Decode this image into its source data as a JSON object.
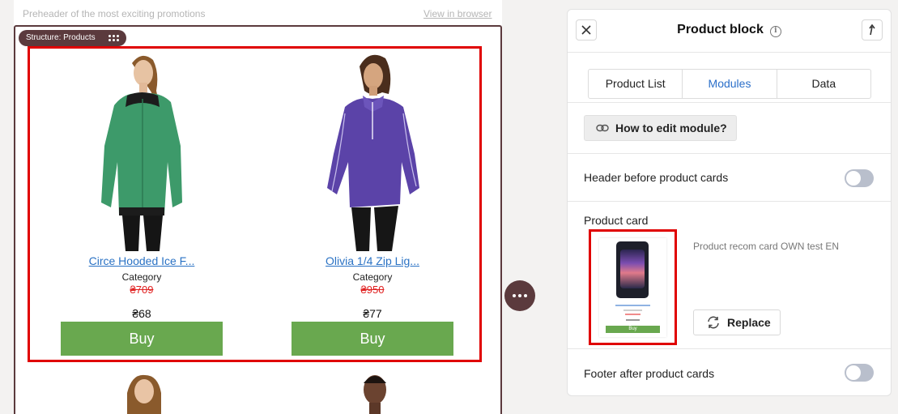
{
  "email": {
    "preheader": "Preheader of the most exciting promotions",
    "view_in_browser": "View in browser",
    "structure_tag": "Structure: Products",
    "products": [
      {
        "name": "Circe Hooded Ice F...",
        "category": "Category",
        "old_price": "₴709",
        "price": "₴68",
        "buy_label": "Buy",
        "jacket_color": "#3d9a6a"
      },
      {
        "name": "Olivia 1/4 Zip Lig...",
        "category": "Category",
        "old_price": "₴950",
        "price": "₴77",
        "buy_label": "Buy",
        "jacket_color": "#5b43a8"
      }
    ]
  },
  "panel": {
    "title": "Product block",
    "tabs": [
      {
        "label": "Product List",
        "active": false
      },
      {
        "label": "Modules",
        "active": true
      },
      {
        "label": "Data",
        "active": false
      }
    ],
    "how_to_edit": "How to edit module?",
    "header_toggle": {
      "label": "Header before product cards",
      "on": false
    },
    "product_card": {
      "label": "Product card",
      "card_name": "Product recom card OWN test EN",
      "thumb_buy": "Buy",
      "replace_label": "Replace"
    },
    "footer_toggle": {
      "label": "Footer after product cards",
      "on": false
    }
  },
  "colors": {
    "accent_blue": "#2b6fc9",
    "structure_brown": "#5b3a3d",
    "buy_green": "#69a84f",
    "selection_red": "#e00000",
    "old_price_red": "#e02020"
  }
}
